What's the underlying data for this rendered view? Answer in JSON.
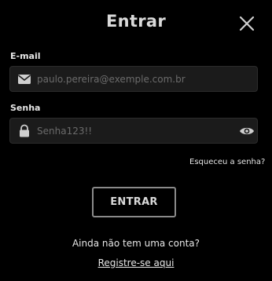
{
  "header": {
    "title": "Entrar",
    "close_icon": "close-icon"
  },
  "email": {
    "label": "E-mail",
    "placeholder": "paulo.pereira@exemple.com.br",
    "value": "",
    "icon": "envelope-icon"
  },
  "password": {
    "label": "Senha",
    "placeholder": "Senha123!!",
    "value": "",
    "icon": "lock-icon",
    "toggle_icon": "eye-icon"
  },
  "forgot_link": "Esqueceu a senha?",
  "submit_label": "ENTRAR",
  "signup": {
    "prompt": "Ainda não tem uma conta?",
    "link": "Registre-se aqui"
  },
  "colors": {
    "background": "#000000",
    "field_bg": "#1b1b1b",
    "button_border": "#8a8a8a",
    "text": "#e6e6e6"
  }
}
